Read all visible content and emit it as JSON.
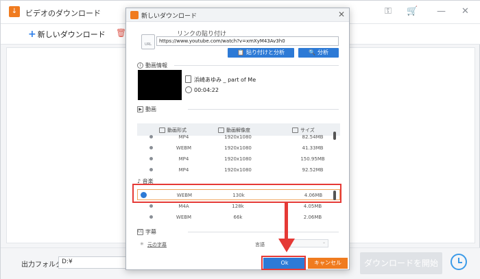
{
  "app": {
    "title": "ビデオのダウンロード",
    "new_download": "新しいダウンロード",
    "output_label": "出力フォルダ：",
    "output_path": "D:¥",
    "start_button": "ダウンロードを開始",
    "controls": {
      "key_icon": "⚿",
      "cart_icon": "🛒",
      "minimize": "—",
      "close": "✕"
    }
  },
  "dialog": {
    "title": "新しいダウンロード",
    "close": "✕",
    "link_label": "リンクの貼り付け",
    "url_icon_text": "URL",
    "url_value": "https://www.youtube.com/watch?v=xmXyM43Av3h0",
    "paste_analyze": "貼り付けと分析",
    "analyze": "分析",
    "video_info_header": "動画情報",
    "video_title": "浜崎あゆみ _ part of Me",
    "video_duration": "00:04:22",
    "video_header": "動画",
    "audio_header": "音楽",
    "subtitle_header": "字幕",
    "columns": [
      "動画形式",
      "動画解像度",
      "サイズ"
    ],
    "video_rows": [
      {
        "format": "MP4",
        "resolution": "1920x1080",
        "size": "82.54MB"
      },
      {
        "format": "WEBM",
        "resolution": "1920x1080",
        "size": "41.33MB"
      },
      {
        "format": "MP4",
        "resolution": "1920x1080",
        "size": "150.95MB"
      },
      {
        "format": "MP4",
        "resolution": "1920x1080",
        "size": "92.52MB"
      }
    ],
    "audio_rows": [
      {
        "format": "WEBM",
        "bitrate": "130k",
        "size": "4.06MB",
        "selected": true
      },
      {
        "format": "M4A",
        "bitrate": "128k",
        "size": "4.05MB",
        "selected": false
      },
      {
        "format": "WEBM",
        "bitrate": "66k",
        "size": "2.06MB",
        "selected": false
      }
    ],
    "subtitle_original": "元の字幕",
    "subtitle_language_label": "言語",
    "ok": "Ok",
    "cancel": "キャンセル"
  },
  "colors": {
    "accent_blue": "#2d7ad6",
    "accent_orange": "#f07b1f",
    "highlight_red": "#e53935"
  }
}
